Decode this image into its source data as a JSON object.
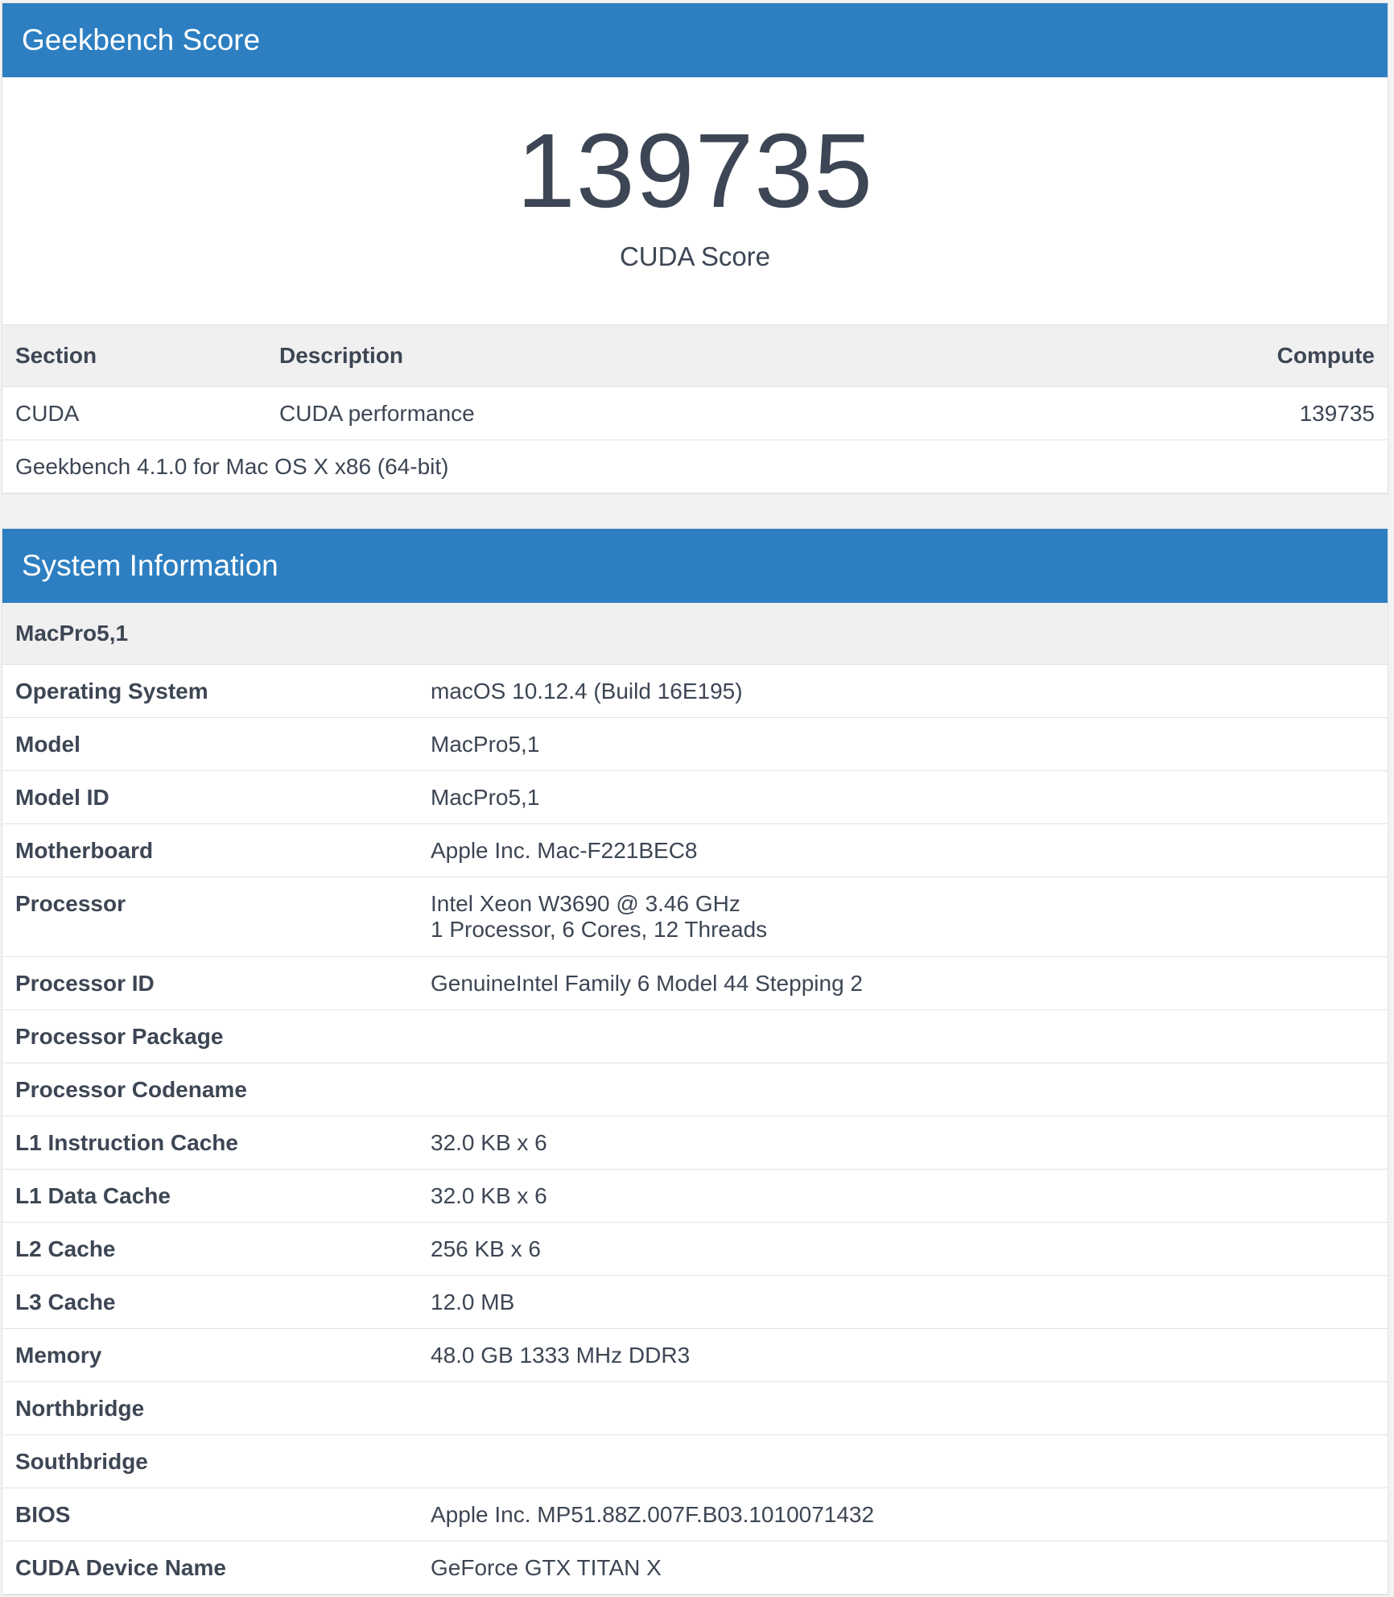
{
  "score_panel": {
    "title": "Geekbench Score",
    "score": "139735",
    "score_label": "CUDA Score",
    "table": {
      "headers": {
        "section": "Section",
        "description": "Description",
        "compute": "Compute"
      },
      "rows": [
        {
          "section": "CUDA",
          "description": "CUDA performance",
          "compute": "139735"
        }
      ]
    },
    "version": "Geekbench 4.1.0 for Mac OS X x86 (64-bit)"
  },
  "system_panel": {
    "title": "System Information",
    "device": "MacPro5,1",
    "rows": [
      {
        "key": "Operating System",
        "value": "macOS 10.12.4 (Build 16E195)",
        "value2": ""
      },
      {
        "key": "Model",
        "value": "MacPro5,1",
        "value2": ""
      },
      {
        "key": "Model ID",
        "value": "MacPro5,1",
        "value2": ""
      },
      {
        "key": "Motherboard",
        "value": "Apple Inc. Mac-F221BEC8",
        "value2": ""
      },
      {
        "key": "Processor",
        "value": "Intel Xeon W3690 @ 3.46 GHz",
        "value2": "1 Processor, 6 Cores, 12 Threads"
      },
      {
        "key": "Processor ID",
        "value": "GenuineIntel Family 6 Model 44 Stepping 2",
        "value2": ""
      },
      {
        "key": "Processor Package",
        "value": "",
        "value2": ""
      },
      {
        "key": "Processor Codename",
        "value": "",
        "value2": ""
      },
      {
        "key": "L1 Instruction Cache",
        "value": "32.0 KB x 6",
        "value2": ""
      },
      {
        "key": "L1 Data Cache",
        "value": "32.0 KB x 6",
        "value2": ""
      },
      {
        "key": "L2 Cache",
        "value": "256 KB x 6",
        "value2": ""
      },
      {
        "key": "L3 Cache",
        "value": "12.0 MB",
        "value2": ""
      },
      {
        "key": "Memory",
        "value": "48.0 GB 1333 MHz DDR3",
        "value2": ""
      },
      {
        "key": "Northbridge",
        "value": "",
        "value2": ""
      },
      {
        "key": "Southbridge",
        "value": "",
        "value2": ""
      },
      {
        "key": "BIOS",
        "value": "Apple Inc. MP51.88Z.007F.B03.1010071432",
        "value2": ""
      },
      {
        "key": "CUDA Device Name",
        "value": "GeForce GTX TITAN X",
        "value2": ""
      }
    ]
  },
  "colors": {
    "header_blue": "#2d7fc1",
    "text": "#3d4654",
    "stripe": "#f0f0f0"
  }
}
